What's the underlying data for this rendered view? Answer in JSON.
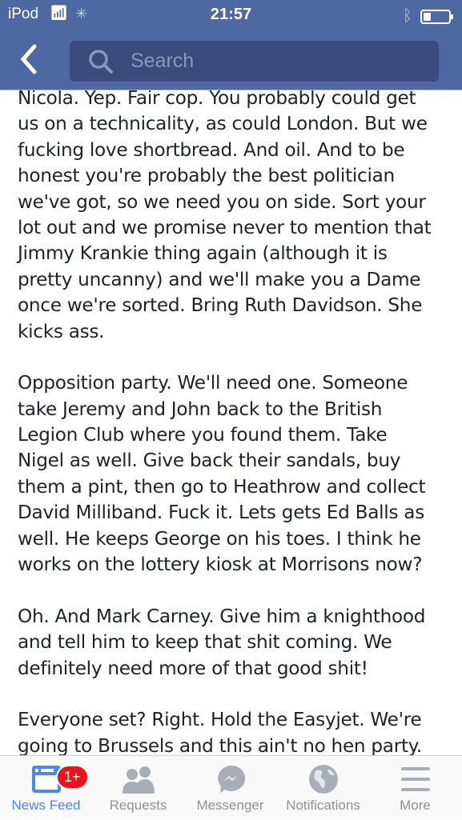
{
  "status": {
    "device": "iPod",
    "time": "21:57"
  },
  "nav": {
    "search_placeholder": "Search"
  },
  "post": {
    "lines": [
      "Nicola. Yep. Fair cop. You probably could get",
      "us on a technicality, as could London. But we",
      "fucking love shortbread. And oil. And to be",
      "honest you're probably the best politician",
      "we've got, so we need you on side. Sort your",
      "lot out and we promise never to mention that",
      "Jimmy Krankie thing again (although it is",
      "pretty uncanny) and we'll make you a Dame",
      "once we're sorted. Bring Ruth Davidson. She",
      "kicks ass.",
      "",
      "Opposition party. We'll need one. Someone",
      "take Jeremy and John back to the British",
      "Legion Club where you found them. Take",
      "Nigel as well. Give back their sandals, buy",
      "them a pint, then go to Heathrow and collect",
      "David Milliband. Fuck it. Lets gets Ed Balls as",
      "well. He keeps George on his toes. I think he",
      "works on the lottery kiosk at Morrisons now?",
      "",
      "Oh. And Mark Carney. Give him a knighthood",
      "and tell him to keep that shit coming. We",
      "definitely need more of that good shit!",
      "",
      "Everyone set? Right. Hold the Easyjet. We're",
      "going to Brussels and this ain't no hen party."
    ]
  },
  "tabbar": {
    "tabs": [
      {
        "label": "News Feed",
        "active": true,
        "badge": "1+"
      },
      {
        "label": "Requests"
      },
      {
        "label": "Messenger"
      },
      {
        "label": "Notifications"
      },
      {
        "label": "More"
      }
    ]
  },
  "colors": {
    "brand": "#4e69a2",
    "active": "#4a87e8",
    "badge": "#e8141e"
  }
}
